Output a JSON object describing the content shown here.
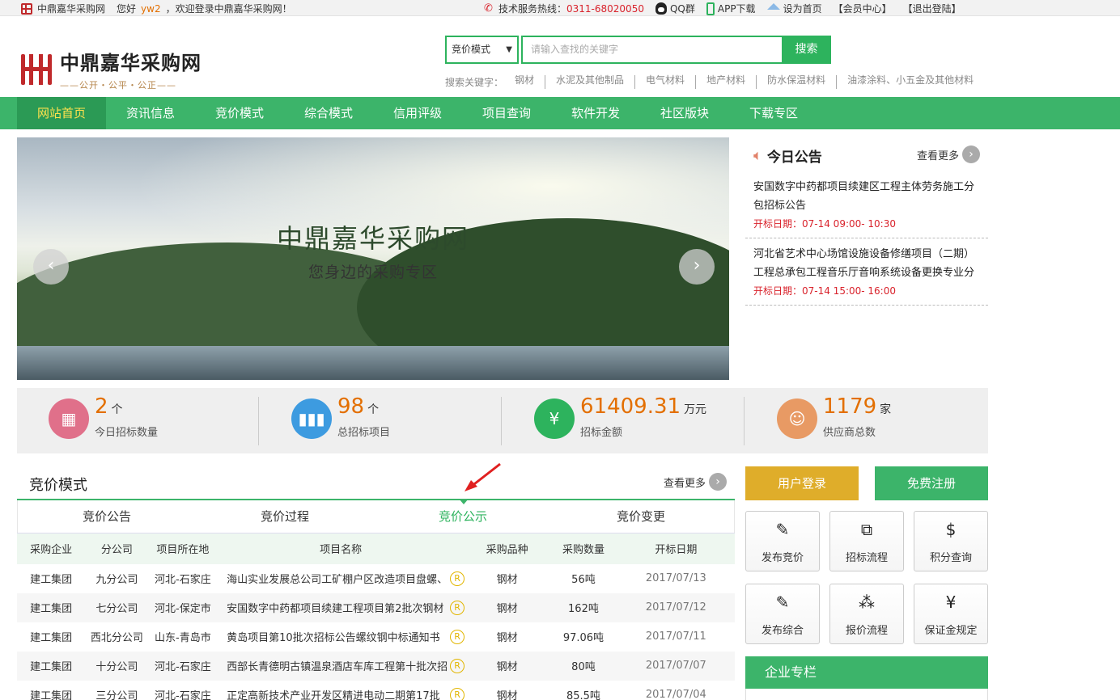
{
  "topbar": {
    "site_name": "中鼎嘉华采购网",
    "greeting_prefix": "您好",
    "username": "yw2",
    "greeting_suffix": "，欢迎登录中鼎嘉华采购网！",
    "hotline_label": "技术服务热线：",
    "hotline_number": "0311-68020050",
    "qq_group": "QQ群",
    "app_download": "APP下载",
    "set_home": "设为首页",
    "member_center": "【会员中心】",
    "logout": "【退出登陆】"
  },
  "header": {
    "logo_name": "中鼎嘉华采购网",
    "logo_slogan": "——公开・公平・公正——",
    "search_mode": "竞价模式",
    "search_placeholder": "请输入查找的关键字",
    "search_button": "搜索",
    "keywords_label": "搜索关键字：",
    "keywords": [
      "钢材",
      "水泥及其他制品",
      "电气材料",
      "地产材料",
      "防水保温材料",
      "油漆涂料、小五金及其他材料"
    ]
  },
  "nav": [
    "网站首页",
    "资讯信息",
    "竞价模式",
    "综合模式",
    "信用评级",
    "项目查询",
    "软件开发",
    "社区版块",
    "下载专区"
  ],
  "banner": {
    "title": "中鼎嘉华采购网",
    "subtitle": "您身边的采购专区",
    "prev": "‹",
    "next": "›"
  },
  "notice": {
    "title": "今日公告",
    "more": "查看更多",
    "items": [
      {
        "text": "安国数字中药都项目续建区工程主体劳务施工分包招标公告",
        "date": "开标日期：07-14 09:00- 10:30"
      },
      {
        "text": "河北省艺术中心场馆设施设备修缮项目（二期）工程总承包工程音乐厅音响系统设备更换专业分",
        "date": "开标日期：07-14 15:00- 16:00"
      }
    ]
  },
  "stats": [
    {
      "value": "2",
      "unit": "个",
      "label": "今日招标数量",
      "color": "#e0708a",
      "icon": "calendar-icon"
    },
    {
      "value": "98",
      "unit": "个",
      "label": "总招标项目",
      "color": "#3d9be0",
      "icon": "bar-chart-icon"
    },
    {
      "value": "61409.31",
      "unit": "万元",
      "label": "招标金额",
      "color": "#2db35d",
      "icon": "yen-icon"
    },
    {
      "value": "1179",
      "unit": "家",
      "label": "供应商总数",
      "color": "#e89a64",
      "icon": "user-icon"
    }
  ],
  "bidding": {
    "title": "竞价模式",
    "more": "查看更多",
    "tabs": [
      "竞价公告",
      "竞价过程",
      "竞价公示",
      "竞价变更"
    ],
    "active_tab": 2,
    "columns": [
      "采购企业",
      "分公司",
      "项目所在地",
      "项目名称",
      "采购品种",
      "采购数量",
      "开标日期"
    ],
    "rows": [
      [
        "建工集团",
        "九分公司",
        "河北-石家庄",
        "海山实业发展总公司工矿棚户区改造项目盘螺、",
        "钢材",
        "56吨",
        "2017/07/13"
      ],
      [
        "建工集团",
        "七分公司",
        "河北-保定市",
        "安国数字中药都项目续建工程项目第2批次钢材",
        "钢材",
        "162吨",
        "2017/07/12"
      ],
      [
        "建工集团",
        "西北分公司",
        "山东-青岛市",
        "黄岛项目第10批次招标公告螺纹钢中标通知书",
        "钢材",
        "97.06吨",
        "2017/07/11"
      ],
      [
        "建工集团",
        "十分公司",
        "河北-石家庄",
        "西部长青德明古镇温泉酒店车库工程第十批次招",
        "钢材",
        "80吨",
        "2017/07/07"
      ],
      [
        "建工集团",
        "三分公司",
        "河北-石家庄",
        "正定高新技术产业开发区精进电动二期第17批",
        "钢材",
        "85.5吨",
        "2017/07/04"
      ]
    ],
    "badge": "R"
  },
  "side": {
    "login": "用户登录",
    "register": "免费注册",
    "quick": [
      {
        "label": "发布竞价",
        "icon": "edit-icon",
        "glyph": "✎"
      },
      {
        "label": "招标流程",
        "icon": "org-chart-icon",
        "glyph": "⧉"
      },
      {
        "label": "积分查询",
        "icon": "coin-search-icon",
        "glyph": "$"
      },
      {
        "label": "发布综合",
        "icon": "edit-icon",
        "glyph": "✎"
      },
      {
        "label": "报价流程",
        "icon": "nodes-icon",
        "glyph": "⁂"
      },
      {
        "label": "保证金规定",
        "icon": "shield-yen-icon",
        "glyph": "¥"
      }
    ],
    "corp_title": "企业专栏"
  }
}
